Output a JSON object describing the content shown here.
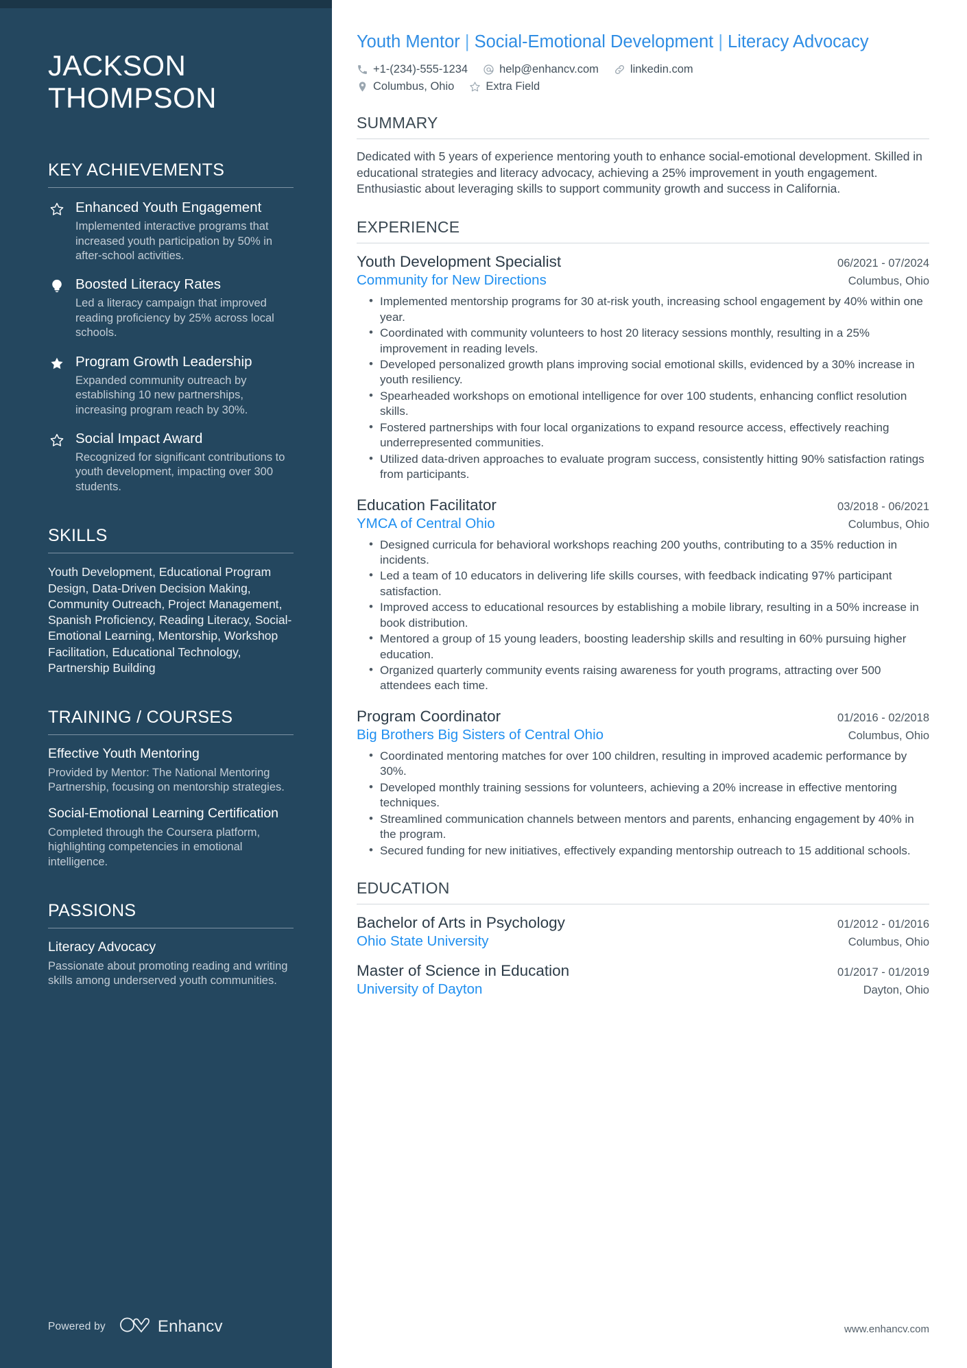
{
  "sidebar": {
    "name": "JACKSON\nTHOMPSON",
    "name_line1": "JACKSON",
    "name_line2": "THOMPSON",
    "sections": {
      "achievements_heading": "KEY ACHIEVEMENTS",
      "skills_heading": "SKILLS",
      "training_heading": "TRAINING / COURSES",
      "passions_heading": "PASSIONS"
    },
    "achievements": [
      {
        "icon": "star-outline-icon",
        "title": "Enhanced Youth Engagement",
        "description": "Implemented interactive programs that increased youth participation by 50% in after-school activities."
      },
      {
        "icon": "lightbulb-icon",
        "title": "Boosted Literacy Rates",
        "description": "Led a literacy campaign that improved reading proficiency by 25% across local schools."
      },
      {
        "icon": "star-filled-icon",
        "title": "Program Growth Leadership",
        "description": "Expanded community outreach by establishing 10 new partnerships, increasing program reach by 30%."
      },
      {
        "icon": "star-outline-icon",
        "title": "Social Impact Award",
        "description": "Recognized for significant contributions to youth development, impacting over 300 students."
      }
    ],
    "skills": "Youth Development, Educational Program Design, Data-Driven Decision Making, Community Outreach, Project Management, Spanish Proficiency, Reading Literacy, Social-Emotional Learning, Mentorship, Workshop Facilitation, Educational Technology, Partnership Building",
    "courses": [
      {
        "title": "Effective Youth Mentoring",
        "description": "Provided by Mentor: The National Mentoring Partnership, focusing on mentorship strategies."
      },
      {
        "title": "Social-Emotional Learning Certification",
        "description": "Completed through the Coursera platform, highlighting competencies in emotional intelligence."
      }
    ],
    "passions": [
      {
        "title": "Literacy Advocacy",
        "description": "Passionate about promoting reading and writing skills among underserved youth communities."
      }
    ],
    "footer": {
      "powered_by": "Powered by",
      "brand": "Enhancv"
    }
  },
  "header": {
    "headline_part1": "Youth Mentor",
    "headline_sep": "|",
    "headline_part2": "Social-Emotional Development",
    "headline_sep2": "|",
    "headline_part3": "Literacy Advocacy",
    "contacts": [
      {
        "icon": "phone-icon",
        "value": "+1-(234)-555-1234"
      },
      {
        "icon": "at-email-icon",
        "value": "help@enhancv.com"
      },
      {
        "icon": "link-icon",
        "value": "linkedin.com"
      }
    ],
    "contacts_row2": [
      {
        "icon": "location-pin-icon",
        "value": "Columbus, Ohio"
      },
      {
        "icon": "star-outline-icon",
        "value": "Extra Field"
      }
    ]
  },
  "main": {
    "summary_heading": "SUMMARY",
    "summary": "Dedicated with 5 years of experience mentoring youth to enhance social-emotional development. Skilled in educational strategies and literacy advocacy, achieving a 25% improvement in youth engagement. Enthusiastic about leveraging skills to support community growth and success in California.",
    "experience_heading": "EXPERIENCE",
    "experience": [
      {
        "title": "Youth Development Specialist",
        "dates": "06/2021 - 07/2024",
        "org": "Community for New Directions",
        "location": "Columbus, Ohio",
        "bullets": [
          "Implemented mentorship programs for 30 at-risk youth, increasing school engagement by 40% within one year.",
          "Coordinated with community volunteers to host 20 literacy sessions monthly, resulting in a 25% improvement in reading levels.",
          "Developed personalized growth plans improving social emotional skills, evidenced by a 30% increase in youth resiliency.",
          "Spearheaded workshops on emotional intelligence for over 100 students, enhancing conflict resolution skills.",
          "Fostered partnerships with four local organizations to expand resource access, effectively reaching underrepresented communities.",
          "Utilized data-driven approaches to evaluate program success, consistently hitting 90% satisfaction ratings from participants."
        ]
      },
      {
        "title": "Education Facilitator",
        "dates": "03/2018 - 06/2021",
        "org": "YMCA of Central Ohio",
        "location": "Columbus, Ohio",
        "bullets": [
          "Designed curricula for behavioral workshops reaching 200 youths, contributing to a 35% reduction in incidents.",
          "Led a team of 10 educators in delivering life skills courses, with feedback indicating 97% participant satisfaction.",
          "Improved access to educational resources by establishing a mobile library, resulting in a 50% increase in book distribution.",
          "Mentored a group of 15 young leaders, boosting leadership skills and resulting in 60% pursuing higher education.",
          "Organized quarterly community events raising awareness for youth programs, attracting over 500 attendees each time."
        ]
      },
      {
        "title": "Program Coordinator",
        "dates": "01/2016 - 02/2018",
        "org": "Big Brothers Big Sisters of Central Ohio",
        "location": "Columbus, Ohio",
        "bullets": [
          "Coordinated mentoring matches for over 100 children, resulting in improved academic performance by 30%.",
          "Developed monthly training sessions for volunteers, achieving a 20% increase in effective mentoring techniques.",
          "Streamlined communication channels between mentors and parents, enhancing engagement by 40% in the program.",
          "Secured funding for new initiatives, effectively expanding mentorship outreach to 15 additional schools."
        ]
      }
    ],
    "education_heading": "EDUCATION",
    "education": [
      {
        "degree": "Bachelor of Arts in Psychology",
        "dates": "01/2012 - 01/2016",
        "school": "Ohio State University",
        "location": "Columbus, Ohio"
      },
      {
        "degree": "Master of Science in Education",
        "dates": "01/2017 - 01/2019",
        "school": "University of Dayton",
        "location": "Dayton, Ohio"
      }
    ],
    "site_url": "www.enhancv.com"
  },
  "colors": {
    "sidebar_bg": "#24475f",
    "accent_blue": "#1f8ff0",
    "headline_blue": "#2f8de4",
    "body_text": "#3f4c57"
  }
}
